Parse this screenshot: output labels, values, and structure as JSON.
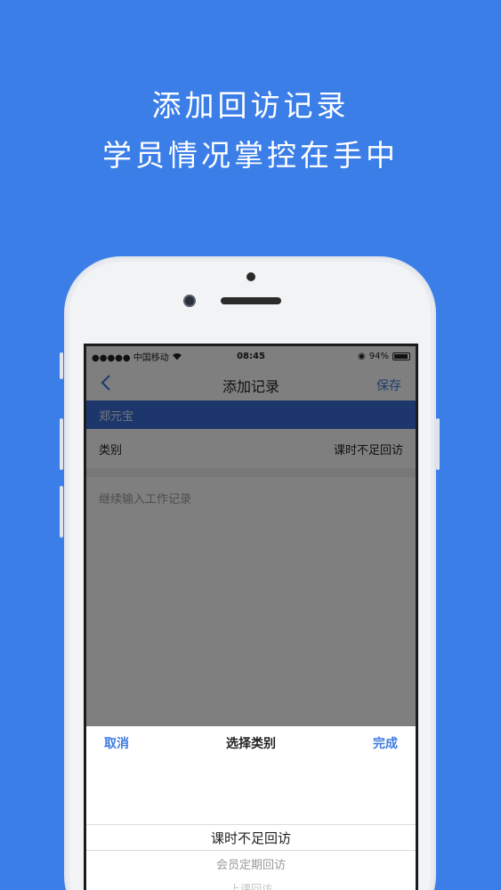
{
  "headline": {
    "line1": "添加回访记录",
    "line2": "学员情况掌控在手中"
  },
  "status_bar": {
    "carrier": "●●●●● 中国移动",
    "wifi_icon": "wifi-icon",
    "time": "08:45",
    "battery_percent": "94%"
  },
  "nav": {
    "back_icon": "chevron-left-icon",
    "title": "添加记录",
    "save_label": "保存"
  },
  "student_name": "郑元宝",
  "category_row": {
    "label": "类别",
    "value": "课时不足回访"
  },
  "work_record": {
    "placeholder": "继续输入工作记录"
  },
  "picker": {
    "cancel_label": "取消",
    "title": "选择类别",
    "done_label": "完成",
    "options": [
      "课时不足回访",
      "会员定期回访",
      "上课回访"
    ]
  },
  "colors": {
    "background": "#3b7ee8",
    "accent": "#3d7be0",
    "name_bar": "#3a6fd8"
  }
}
